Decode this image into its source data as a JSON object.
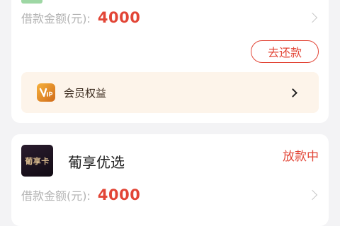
{
  "loan_card": {
    "amount_label": "借款金额(元):",
    "amount_value": "4000",
    "repay_button": "去还款",
    "vip": {
      "icon": "vip-badge-icon",
      "label": "会员权益"
    }
  },
  "product_card": {
    "logo_text": "葡享卡",
    "name": "葡享优选",
    "status": "放款中",
    "amount_label": "借款金额(元):",
    "amount_value": "4000"
  },
  "colors": {
    "accent_red": "#e24536",
    "vip_background": "#fdf4ea",
    "page_background": "#f3f3f5"
  }
}
